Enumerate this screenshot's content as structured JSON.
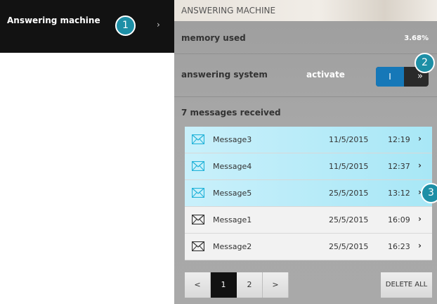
{
  "left_menu": {
    "label": "Answering machine",
    "chevron": "›"
  },
  "callouts": [
    "1",
    "2",
    "3"
  ],
  "panel": {
    "title": "ANSWERING MACHINE",
    "memory": {
      "label": "memory used",
      "value": "3.68%"
    },
    "answering_system": {
      "label": "answering system",
      "status": "activate",
      "toggle_on": "I",
      "toggle_off": "»"
    },
    "messages_header": "7 messages received",
    "messages": [
      {
        "name": "Message3",
        "date": "11/5/2015",
        "time": "12:19",
        "chevron": "›",
        "state": "unread"
      },
      {
        "name": "Message4",
        "date": "11/5/2015",
        "time": "12:37",
        "chevron": "›",
        "state": "unread"
      },
      {
        "name": "Message5",
        "date": "25/5/2015",
        "time": "13:12",
        "chevron": "›",
        "state": "unread"
      },
      {
        "name": "Message1",
        "date": "25/5/2015",
        "time": "16:09",
        "chevron": "›",
        "state": "read"
      },
      {
        "name": "Message2",
        "date": "25/5/2015",
        "time": "16:23",
        "chevron": "›",
        "state": "read"
      }
    ],
    "pagination": {
      "prev": "<",
      "pages": [
        "1",
        "2"
      ],
      "active_page": "1",
      "next": ">"
    },
    "delete_all": "DELETE ALL"
  },
  "icons": {
    "message_unread": "envelope-icon",
    "message_read": "envelope-icon"
  },
  "colors": {
    "accent": "#1d8fa6",
    "toggle_on": "#1678b8",
    "unread_row": "#b8ecf8",
    "menu_bg": "#121212"
  }
}
